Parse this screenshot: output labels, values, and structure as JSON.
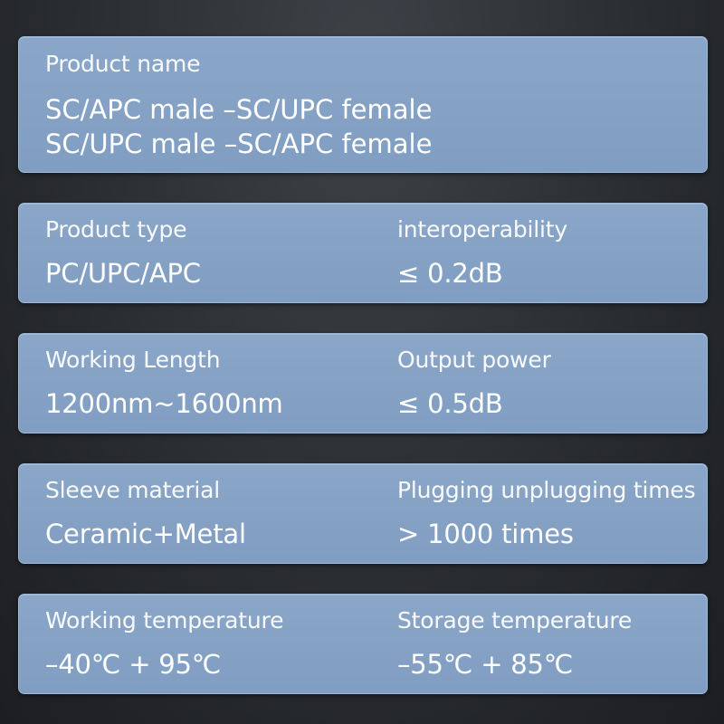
{
  "cards": [
    {
      "label": "Product name",
      "lines": [
        "SC/APC male –SC/UPC female",
        "SC/UPC male –SC/APC female"
      ]
    },
    {
      "left": {
        "label": "Product type",
        "value": "PC/UPC/APC"
      },
      "right": {
        "label": "interoperability",
        "value": "≤ 0.2dB"
      }
    },
    {
      "left": {
        "label": "Working Length",
        "value": "1200nm~1600nm"
      },
      "right": {
        "label": "Output power",
        "value": "≤ 0.5dB"
      }
    },
    {
      "left": {
        "label": "Sleeve material",
        "value": "Ceramic+Metal"
      },
      "right": {
        "label": "Plugging unplugging times",
        "value": "> 1000 times"
      }
    },
    {
      "left": {
        "label": "Working temperature",
        "value": "–40℃ + 95℃"
      },
      "right": {
        "label": "Storage temperature",
        "value": "–55℃ + 85℃"
      }
    }
  ],
  "colors": {
    "card_background": "#86a2c5",
    "page_background": "#2a2d31",
    "text": "#ffffff"
  }
}
